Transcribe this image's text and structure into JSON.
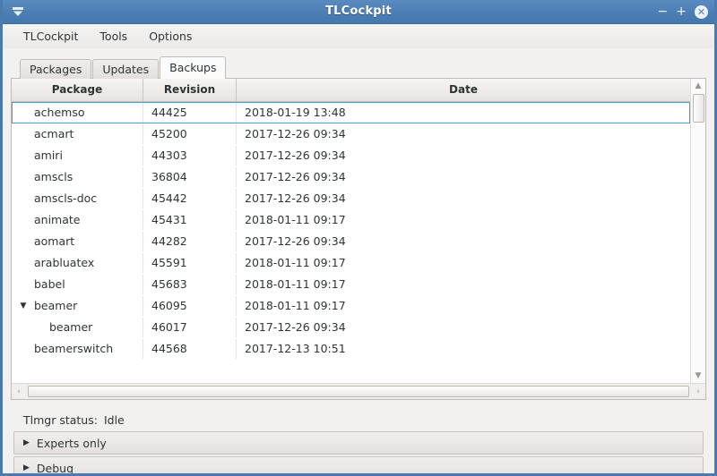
{
  "window": {
    "title": "TLCockpit",
    "menu_icon": "window-menu-icon",
    "minimize_label": "−",
    "maximize_label": "+",
    "close_label": "✕"
  },
  "menubar": {
    "items": [
      {
        "label": "TLCockpit"
      },
      {
        "label": "Tools"
      },
      {
        "label": "Options"
      }
    ]
  },
  "tabs": [
    {
      "label": "Packages",
      "active": false
    },
    {
      "label": "Updates",
      "active": false
    },
    {
      "label": "Backups",
      "active": true
    }
  ],
  "table": {
    "columns": [
      {
        "label": "Package"
      },
      {
        "label": "Revision"
      },
      {
        "label": "Date"
      }
    ],
    "rows": [
      {
        "package": "achemso",
        "revision": "44425",
        "date": "2018-01-19 13:48",
        "expander": "",
        "child": false,
        "focused": true
      },
      {
        "package": "acmart",
        "revision": "45200",
        "date": "2017-12-26 09:34",
        "expander": "",
        "child": false,
        "focused": false
      },
      {
        "package": "amiri",
        "revision": "44303",
        "date": "2017-12-26 09:34",
        "expander": "",
        "child": false,
        "focused": false
      },
      {
        "package": "amscls",
        "revision": "36804",
        "date": "2017-12-26 09:34",
        "expander": "",
        "child": false,
        "focused": false
      },
      {
        "package": "amscls-doc",
        "revision": "45442",
        "date": "2017-12-26 09:34",
        "expander": "",
        "child": false,
        "focused": false
      },
      {
        "package": "animate",
        "revision": "45431",
        "date": "2018-01-11 09:17",
        "expander": "",
        "child": false,
        "focused": false
      },
      {
        "package": "aomart",
        "revision": "44282",
        "date": "2017-12-26 09:34",
        "expander": "",
        "child": false,
        "focused": false
      },
      {
        "package": "arabluatex",
        "revision": "45591",
        "date": "2018-01-11 09:17",
        "expander": "",
        "child": false,
        "focused": false
      },
      {
        "package": "babel",
        "revision": "45683",
        "date": "2018-01-11 09:17",
        "expander": "",
        "child": false,
        "focused": false
      },
      {
        "package": "beamer",
        "revision": "46095",
        "date": "2018-01-11 09:17",
        "expander": "▼",
        "child": false,
        "focused": false
      },
      {
        "package": "beamer",
        "revision": "46017",
        "date": "2017-12-26 09:34",
        "expander": "",
        "child": true,
        "focused": false
      },
      {
        "package": "beamerswitch",
        "revision": "44568",
        "date": "2017-12-13 10:51",
        "expander": "",
        "child": false,
        "focused": false
      }
    ]
  },
  "scrollbars": {
    "v_up": "▲",
    "v_down": "▼",
    "h_left": "‹",
    "h_right": "›"
  },
  "status": {
    "label": "Tlmgr status:",
    "value": "Idle"
  },
  "expanders": [
    {
      "label": "Experts only",
      "triangle": "▶"
    },
    {
      "label": "Debug",
      "triangle": "▶"
    }
  ],
  "colors": {
    "titlebar": "#4d7fb5",
    "window_border": "#4a7aaf",
    "focus_outline": "#4aa3c7",
    "panel_bg": "#f2f1f0",
    "text": "#2e3436"
  }
}
